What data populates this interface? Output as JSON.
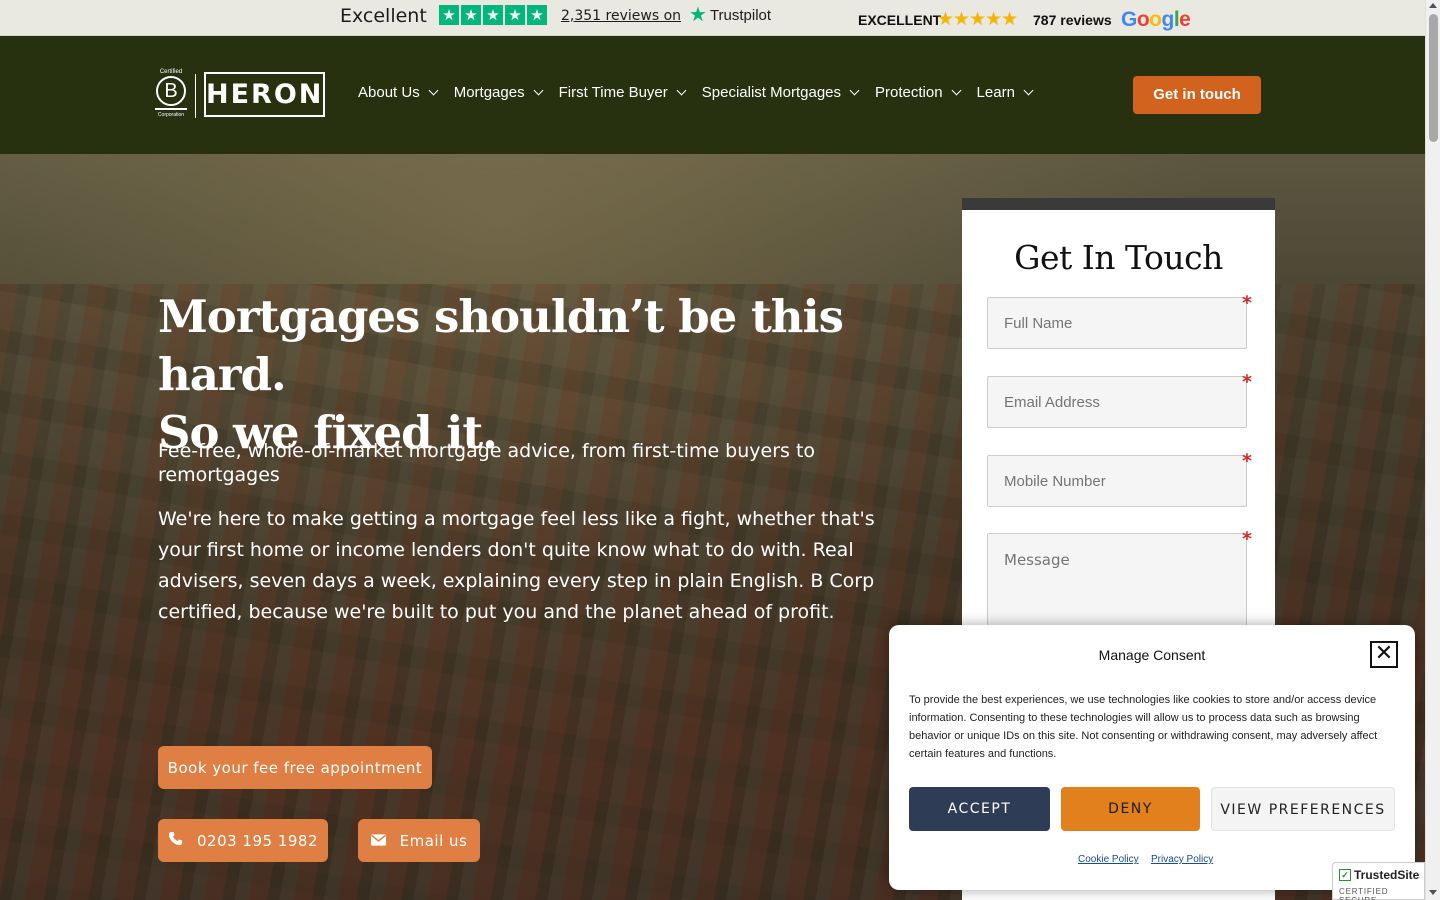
{
  "review_bar": {
    "trustpilot": {
      "rating_word": "Excellent",
      "stars": 5,
      "reviews_link": "2,351 reviews on",
      "brand": "Trustpilot"
    },
    "google": {
      "rating_word": "EXCELLENT",
      "stars": 5,
      "reviews": "787 reviews",
      "brand_letters": [
        "G",
        "o",
        "o",
        "g",
        "l",
        "e"
      ]
    }
  },
  "header": {
    "bcorp": {
      "top": "Certified",
      "letter": "B",
      "bottom": "Corporation"
    },
    "logo_text": "HERON",
    "nav": [
      {
        "label": "About Us"
      },
      {
        "label": "Mortgages"
      },
      {
        "label": "First Time Buyer"
      },
      {
        "label": "Specialist Mortgages"
      },
      {
        "label": "Protection"
      },
      {
        "label": "Learn"
      }
    ],
    "cta_label": "Get in touch",
    "background": "#27300f",
    "accent": "#d2631f"
  },
  "hero": {
    "title_line1": "Mortgages shouldn’t be this hard.",
    "title_line2": "So we fixed it.",
    "subtitle": "Fee-free, whole-of-market mortgage advice, from first-time buyers to remortgages",
    "body": "We're here to make getting a mortgage feel less like a fight, whether that's your first home or income lenders don't quite know what to do with. Real advisers, seven days a week, explaining every step in plain English. B Corp certified, because we're built to put you and the planet ahead of profit.",
    "book_label": "Book your fee free appointment",
    "phone_label": "0203 195 1982",
    "email_label": "Email us",
    "button_color": "#e07f44"
  },
  "form": {
    "title": "Get In Touch",
    "required_mark": "*",
    "fields": [
      {
        "placeholder": "Full Name"
      },
      {
        "placeholder": "Email Address"
      },
      {
        "placeholder": "Mobile Number"
      },
      {
        "placeholder": "Message"
      }
    ]
  },
  "consent": {
    "title": "Manage Consent",
    "close_glyph": "✕",
    "text": "To provide the best experiences, we use technologies like cookies to store and/or access device information. Consenting to these technologies will allow us to process data such as browsing behavior or unique IDs on this site. Not consenting or withdrawing consent, may adversely affect certain features and functions.",
    "accept_label": "ACCEPT",
    "deny_label": "DENY",
    "prefs_label": "VIEW PREFERENCES",
    "cookie_link": "Cookie Policy",
    "privacy_link": "Privacy Policy",
    "accept_color": "#2e3d55",
    "deny_color": "#e1801c"
  },
  "trusted_badge": {
    "title": "TrustedSite",
    "subtitle": "CERTIFIED SECURE"
  }
}
